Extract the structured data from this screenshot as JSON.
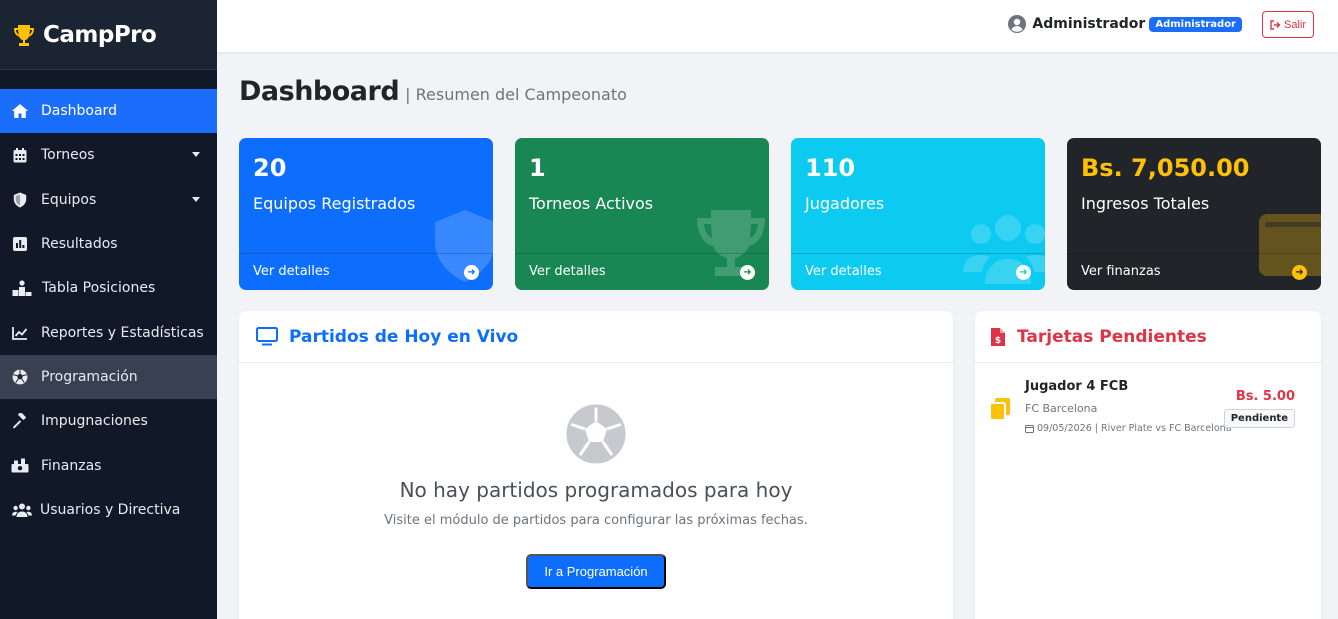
{
  "brand": {
    "name": "CampPro",
    "accent": "#ffc107"
  },
  "sidebar": {
    "items": [
      {
        "label": "Dashboard",
        "icon": "home-icon"
      },
      {
        "label": "Torneos",
        "icon": "calendar-icon"
      },
      {
        "label": "Equipos",
        "icon": "shield-icon"
      },
      {
        "label": "Resultados",
        "icon": "poll-icon"
      },
      {
        "label": "Tabla Posiciones",
        "icon": "podium-icon"
      },
      {
        "label": "Reportes y Estadísticas",
        "icon": "chart-line-icon"
      },
      {
        "label": "Programación",
        "icon": "soccer-ball-icon"
      },
      {
        "label": "Impugnaciones",
        "icon": "gavel-icon"
      },
      {
        "label": "Finanzas",
        "icon": "money-icon"
      },
      {
        "label": "Usuarios y Directiva",
        "icon": "users-icon"
      }
    ]
  },
  "topbar": {
    "user_name": "Administrador",
    "role_badge": "Administrador",
    "logout_label": "Salir"
  },
  "page": {
    "title": "Dashboard",
    "subtitle": "| Resumen del Campeonato"
  },
  "stats": [
    {
      "value": "20",
      "label": "Equipos Registrados",
      "link": "Ver detalles",
      "color": "#0d6efd"
    },
    {
      "value": "1",
      "label": "Torneos Activos",
      "link": "Ver detalles",
      "color": "#198754"
    },
    {
      "value": "110",
      "label": "Jugadores",
      "link": "Ver detalles",
      "color": "#0dcaf0"
    },
    {
      "value": "Bs. 7,050.00",
      "label": "Ingresos Totales",
      "link": "Ver finanzas",
      "color": "#212529"
    }
  ],
  "live": {
    "title": "Partidos de Hoy en Vivo",
    "empty_title": "No hay partidos programados para hoy",
    "empty_text": "Visite el módulo de partidos para configurar las próximas fechas.",
    "button": "Ir a Programación"
  },
  "cards": {
    "title": "Tarjetas Pendientes",
    "items": [
      {
        "player": "Jugador 4 FCB",
        "team": "FC Barcelona",
        "meta": "09/05/2026 | River Plate vs FC Barcelona",
        "amount": "Bs. 5.00",
        "status": "Pendiente"
      }
    ]
  }
}
